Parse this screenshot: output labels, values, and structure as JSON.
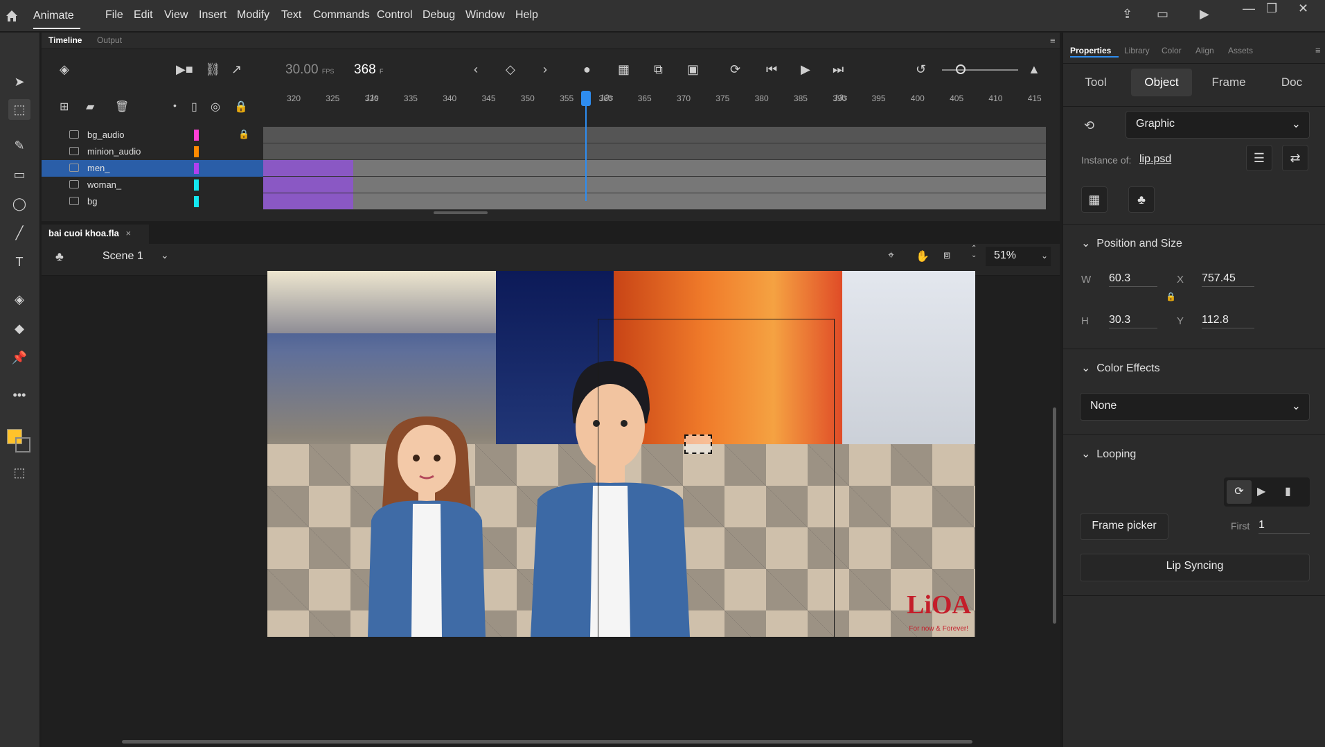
{
  "app": {
    "name": "Animate"
  },
  "menu": [
    "File",
    "Edit",
    "View",
    "Insert",
    "Modify",
    "Text",
    "Commands",
    "Control",
    "Debug",
    "Window",
    "Help"
  ],
  "timeline": {
    "tabs": [
      "Timeline",
      "Output"
    ],
    "fps": "30.00",
    "fps_unit": "FPS",
    "current_frame": "368",
    "frame_unit": "F",
    "second_labels": [
      "11s",
      "12s",
      "13s"
    ],
    "ticks": [
      "320",
      "325",
      "330",
      "335",
      "340",
      "345",
      "350",
      "355",
      "360",
      "365",
      "370",
      "375",
      "380",
      "385",
      "390",
      "395",
      "400",
      "405",
      "410",
      "415"
    ],
    "layers": [
      {
        "name": "bg_audio",
        "color": "#ff3fd6",
        "locked": true
      },
      {
        "name": "minion_audio",
        "color": "#ff8a00",
        "locked": false
      },
      {
        "name": "men_",
        "color": "#b03ff0",
        "locked": false,
        "selected": true
      },
      {
        "name": "woman_",
        "color": "#13e7f0",
        "locked": false
      },
      {
        "name": "bg",
        "color": "#13e7f0",
        "locked": false
      }
    ]
  },
  "document": {
    "tab_title": "bai cuoi khoa.fla",
    "scene": "Scene 1",
    "zoom": "51%",
    "watermark": "LiOA",
    "watermark_sub": "For now & Forever!"
  },
  "properties": {
    "tabs": [
      "Properties",
      "Library",
      "Color",
      "Align",
      "Assets"
    ],
    "subtabs": [
      "Tool",
      "Object",
      "Frame",
      "Doc"
    ],
    "symbol_type": "Graphic",
    "instance_label": "Instance of:",
    "instance_value": "lip.psd",
    "position_size_title": "Position and Size",
    "w_label": "W",
    "w_value": "60.3",
    "h_label": "H",
    "h_value": "30.3",
    "x_label": "X",
    "x_value": "757.45",
    "y_label": "Y",
    "y_value": "112.8",
    "color_effects_title": "Color Effects",
    "color_effect": "None",
    "looping_title": "Looping",
    "frame_picker": "Frame picker",
    "first_label": "First",
    "first_value": "1",
    "lip_syncing": "Lip Syncing"
  },
  "colors": {
    "accent": "#2e8df0",
    "fill_swatch": "#ffc32b"
  }
}
